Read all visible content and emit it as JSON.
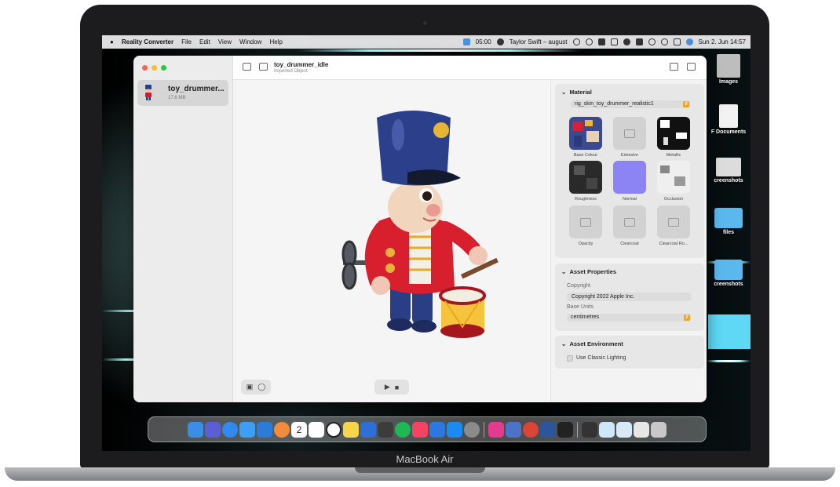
{
  "device": {
    "label": "MacBook Air"
  },
  "menubar": {
    "app": "Reality Converter",
    "menus": [
      "File",
      "Edit",
      "View",
      "Window",
      "Help"
    ],
    "timer": "05:00",
    "now_playing": "Taylor Swift – august",
    "datetime": "Sun 2. Jun  14:57"
  },
  "window": {
    "file": {
      "name": "toy_drummer...",
      "size": "17,6 MB"
    },
    "toolbar": {
      "title": "toy_drummer_idle",
      "subtitle": "Imported Object"
    },
    "inspector": {
      "material": {
        "header": "Material",
        "selected": "rig_skin_toy_drummer_realistic1",
        "textures": [
          "Base Colour",
          "Emissive",
          "Metallic",
          "Roughness",
          "Normal",
          "Occlusion",
          "Opacity",
          "Clearcoat",
          "Clearcoat Ro..."
        ]
      },
      "asset_properties": {
        "header": "Asset Properties",
        "copyright_label": "Copyright",
        "copyright_value": "Copyright 2022 Apple Inc.",
        "units_label": "Base Units",
        "units_value": "centimetres"
      },
      "asset_environment": {
        "header": "Asset Environment",
        "classic_lighting": "Use Classic Lighting"
      }
    }
  },
  "desktop": {
    "items": [
      "Images",
      "F Documents",
      "creenshots",
      "files",
      "creenshots"
    ]
  },
  "dock": {
    "calendar_day": "2"
  },
  "colors": {
    "accent": "#f0a522",
    "normal_map": "#8c84f5",
    "folder": "#5bb8ef"
  }
}
